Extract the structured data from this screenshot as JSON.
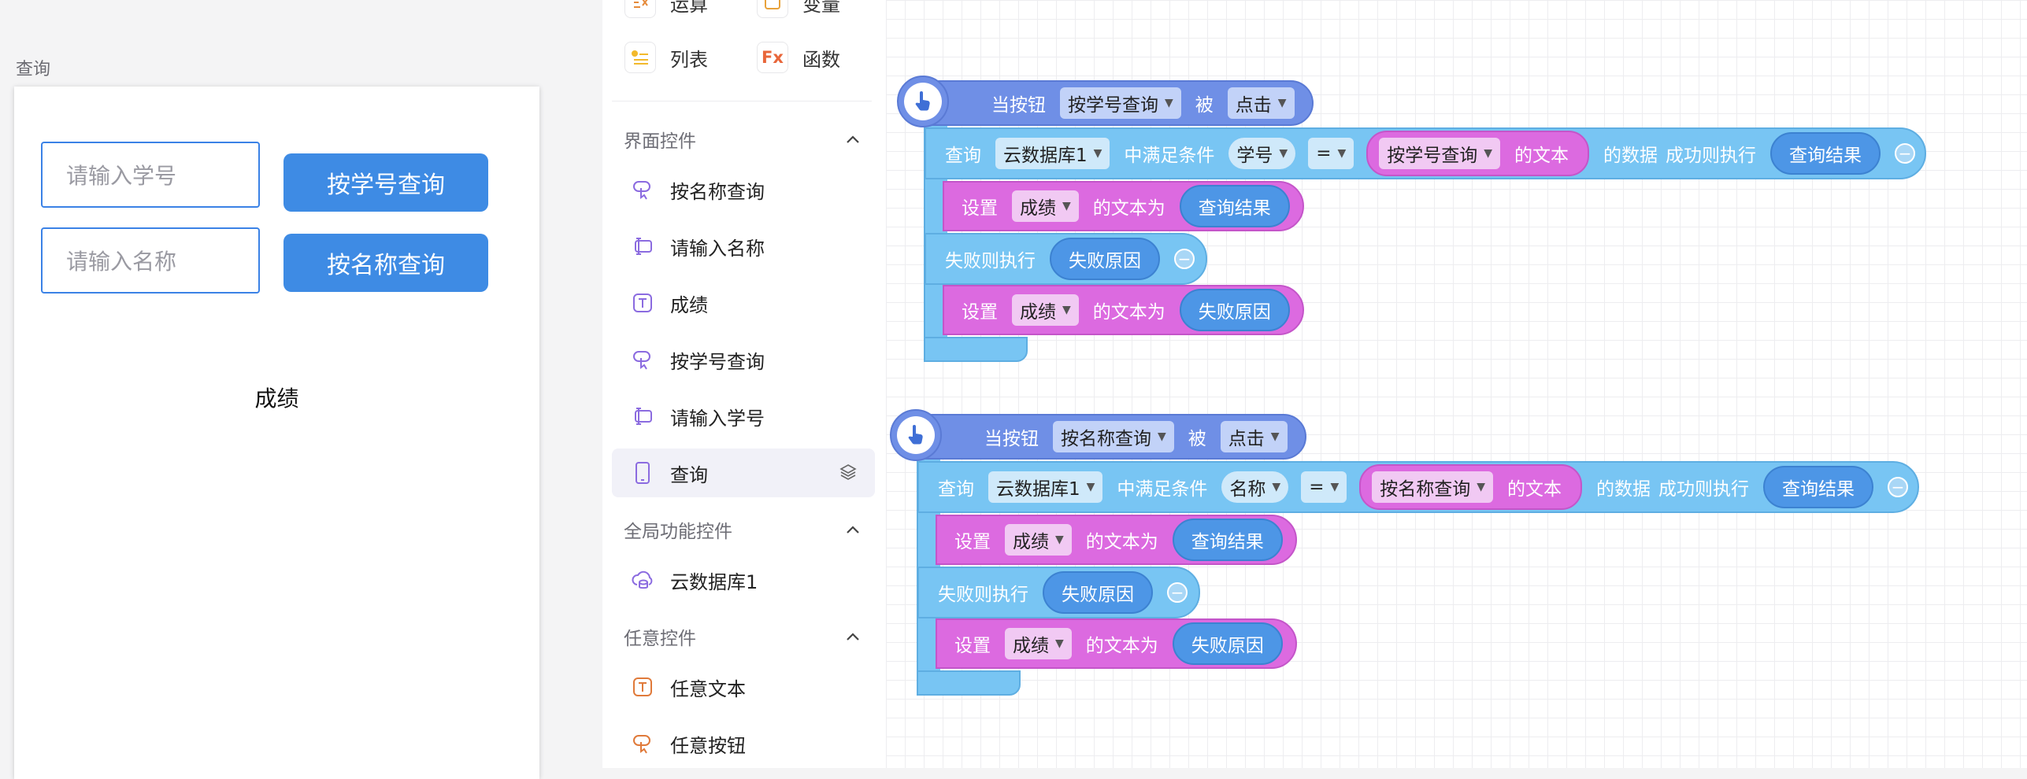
{
  "preview": {
    "screen_name": "查询",
    "input_student_id_placeholder": "请输入学号",
    "input_name_placeholder": "请输入名称",
    "btn_by_id": "按学号查询",
    "btn_by_name": "按名称查询",
    "result_label": "成绩"
  },
  "panel": {
    "categories": [
      {
        "label": "运算",
        "icon": "operator-icon"
      },
      {
        "label": "变量",
        "icon": "variable-icon"
      },
      {
        "label": "列表",
        "icon": "list-icon"
      },
      {
        "label": "函数",
        "icon": "function-icon",
        "glyph": "Fx"
      }
    ],
    "sections": [
      {
        "title": "界面控件",
        "items": [
          "按名称查询",
          "请输入名称",
          "成绩",
          "按学号查询",
          "请输入学号",
          "查询"
        ]
      },
      {
        "title": "全局功能控件",
        "items": [
          "云数据库1"
        ]
      },
      {
        "title": "任意控件",
        "items": [
          "任意文本",
          "任意按钮"
        ]
      }
    ]
  },
  "blocks": {
    "when_button": "当按钮",
    "is": "被",
    "click": "点击",
    "query": "查询",
    "db": "云数据库1",
    "condition": "中满足条件",
    "equals": "=",
    "text_of": "的文本",
    "data_of": "的数据",
    "success": "成功则执行",
    "query_result": "查询结果",
    "set": "设置",
    "score": "成绩",
    "text_is": "的文本为",
    "fail": "失败则执行",
    "fail_reason": "失败原因",
    "group1": {
      "button": "按学号查询",
      "field": "学号",
      "source": "按学号查询"
    },
    "group2": {
      "button": "按名称查询",
      "field": "名称",
      "source": "按名称查询"
    }
  },
  "colors": {
    "event": "#6f8fe6",
    "query": "#78c5f3",
    "set": "#dc6ae0",
    "button": "#3e8be4"
  }
}
